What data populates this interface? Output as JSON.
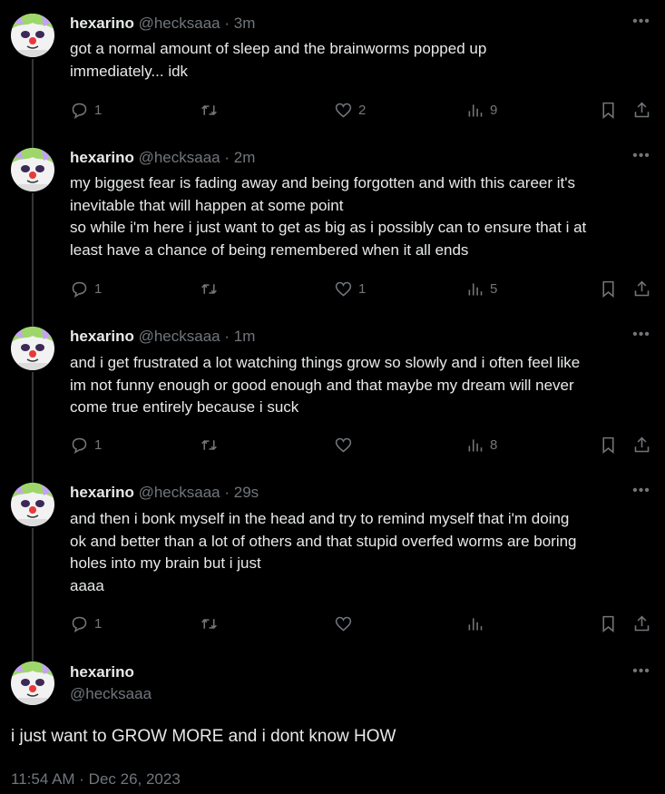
{
  "colors": {
    "background": "#000000",
    "text": "#e7e9ea",
    "muted": "#71767b",
    "thread_line": "#333639"
  },
  "tweets": [
    {
      "name": "hexarino",
      "handle": "@hecksaaa",
      "time": "3m",
      "text": "got a normal amount of sleep and the brainworms popped up\nimmediately... idk",
      "replies": "1",
      "retweets": "",
      "likes": "2",
      "views": "9"
    },
    {
      "name": "hexarino",
      "handle": "@hecksaaa",
      "time": "2m",
      "text": "my biggest fear is fading away and being forgotten and with this career it's\ninevitable that will happen at some point\nso while i'm here i just want to get as big as i possibly can to ensure that i at\nleast have a chance of being remembered when it all ends",
      "replies": "1",
      "retweets": "",
      "likes": "1",
      "views": "5"
    },
    {
      "name": "hexarino",
      "handle": "@hecksaaa",
      "time": "1m",
      "text": "and i get frustrated a lot watching things grow so slowly and i often feel like\nim not funny enough or good enough and that maybe my dream will never\ncome true entirely because i suck",
      "replies": "1",
      "retweets": "",
      "likes": "",
      "views": "8"
    },
    {
      "name": "hexarino",
      "handle": "@hecksaaa",
      "time": "29s",
      "text": "and then i bonk myself in the head and try to remind myself that i'm doing\nok and better than a lot of others and that stupid overfed worms are boring\nholes into my brain but i just\naaaa",
      "replies": "1",
      "retweets": "",
      "likes": "",
      "views": ""
    }
  ],
  "main_tweet": {
    "name": "hexarino",
    "handle": "@hecksaaa",
    "text": "i just want to GROW MORE and i dont know HOW",
    "timestamp": "11:54 AM · Dec 26, 2023"
  },
  "icons": {
    "reply": "reply-icon",
    "retweet": "retweet-icon",
    "like": "heart-icon",
    "views": "views-icon",
    "bookmark": "bookmark-icon",
    "share": "share-icon",
    "more": "more-icon"
  }
}
